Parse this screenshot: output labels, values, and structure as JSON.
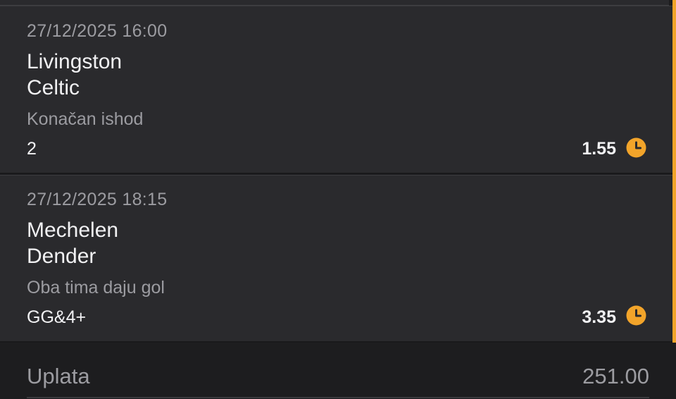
{
  "ticket": {
    "matches": [
      {
        "datetime": "27/12/2025 16:00",
        "home": "Livingston",
        "away": "Celtic",
        "market": "Konačan ishod",
        "selection": "2",
        "odds": "1.55",
        "status_icon": "clock-icon"
      },
      {
        "datetime": "27/12/2025 18:15",
        "home": "Mechelen",
        "away": "Dender",
        "market": "Oba tima daju gol",
        "selection": "GG&4+",
        "odds": "3.35",
        "status_icon": "clock-icon"
      }
    ],
    "summary": {
      "label": "Uplata",
      "value": "251.00"
    }
  },
  "colors": {
    "accent": "#f2a42a",
    "card_bg": "#2a2a2d",
    "page_bg": "#1d1d1f",
    "text_primary": "#f1f1f3",
    "text_secondary": "#9c9ca1"
  }
}
